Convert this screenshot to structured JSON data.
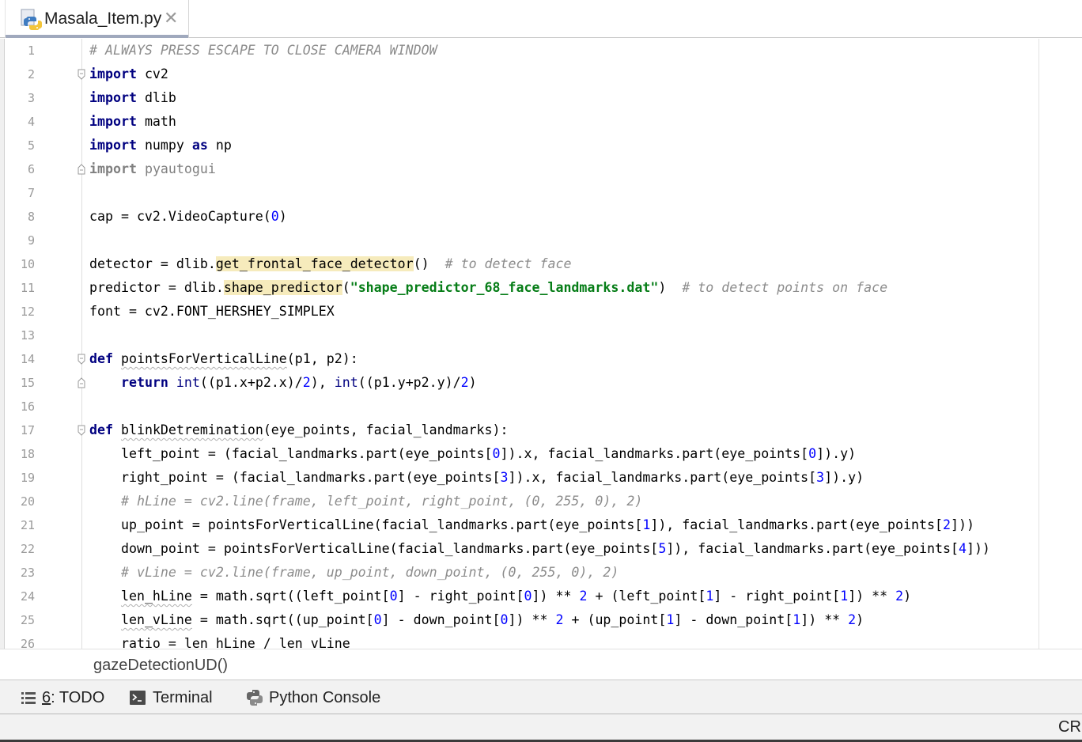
{
  "tab": {
    "filename": "Masala_Item.py",
    "close_glyph": "✕"
  },
  "editor": {
    "line_numbers": [
      "1",
      "2",
      "3",
      "4",
      "5",
      "6",
      "7",
      "8",
      "9",
      "10",
      "11",
      "12",
      "13",
      "14",
      "15",
      "16",
      "17",
      "18",
      "19",
      "20",
      "21",
      "22",
      "23",
      "24",
      "25",
      "26"
    ]
  },
  "breadcrumb": {
    "function": "gazeDetectionUD()"
  },
  "tool_windows": {
    "todo": {
      "mnemonic": "6",
      "rest": ": TODO"
    },
    "terminal": {
      "label": "Terminal"
    },
    "python_console": {
      "label": "Python Console"
    }
  },
  "status": {
    "right_text": "CRLF"
  },
  "colors": {
    "keyword": "#000080",
    "comment": "#8c8c8c",
    "number": "#0000ff",
    "string": "#067d17",
    "highlight": "#f6ebbc"
  }
}
